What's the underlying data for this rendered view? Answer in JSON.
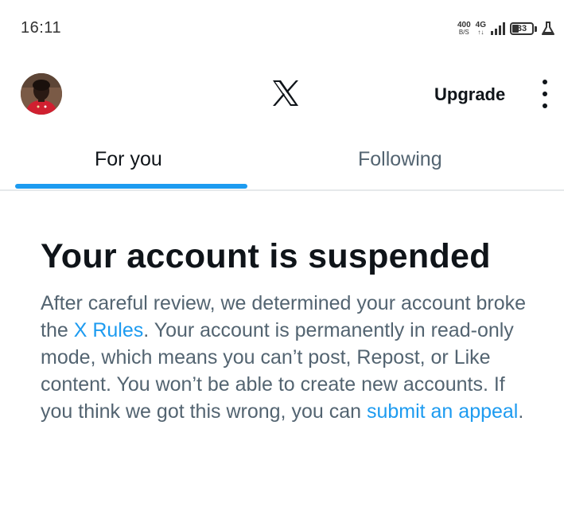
{
  "status_bar": {
    "time": "16:11",
    "net_speed_value": "400",
    "net_speed_unit": "B/S",
    "network_type": "4G",
    "network_arrows": "↑↓",
    "battery_level": "33",
    "battery_fraction": 0.33
  },
  "header": {
    "upgrade_label": "Upgrade"
  },
  "tabs": [
    {
      "label": "For you",
      "active": true
    },
    {
      "label": "Following",
      "active": false
    }
  ],
  "main": {
    "title": "Your account is suspended",
    "body": {
      "part1": "After careful review, we determined your account broke the ",
      "rules_link": "X Rules",
      "part2": ". Your account is permanently in read-only mode, which means you can’t post, Repost, or Like content. You won’t be able to create new accounts. If you think we got this wrong, you can ",
      "appeal_link": "submit an appeal",
      "part3": "."
    }
  },
  "colors": {
    "accent": "#1d9bf0",
    "text_primary": "#0f1419",
    "text_secondary": "#536471",
    "divider": "#e6e9eb"
  }
}
